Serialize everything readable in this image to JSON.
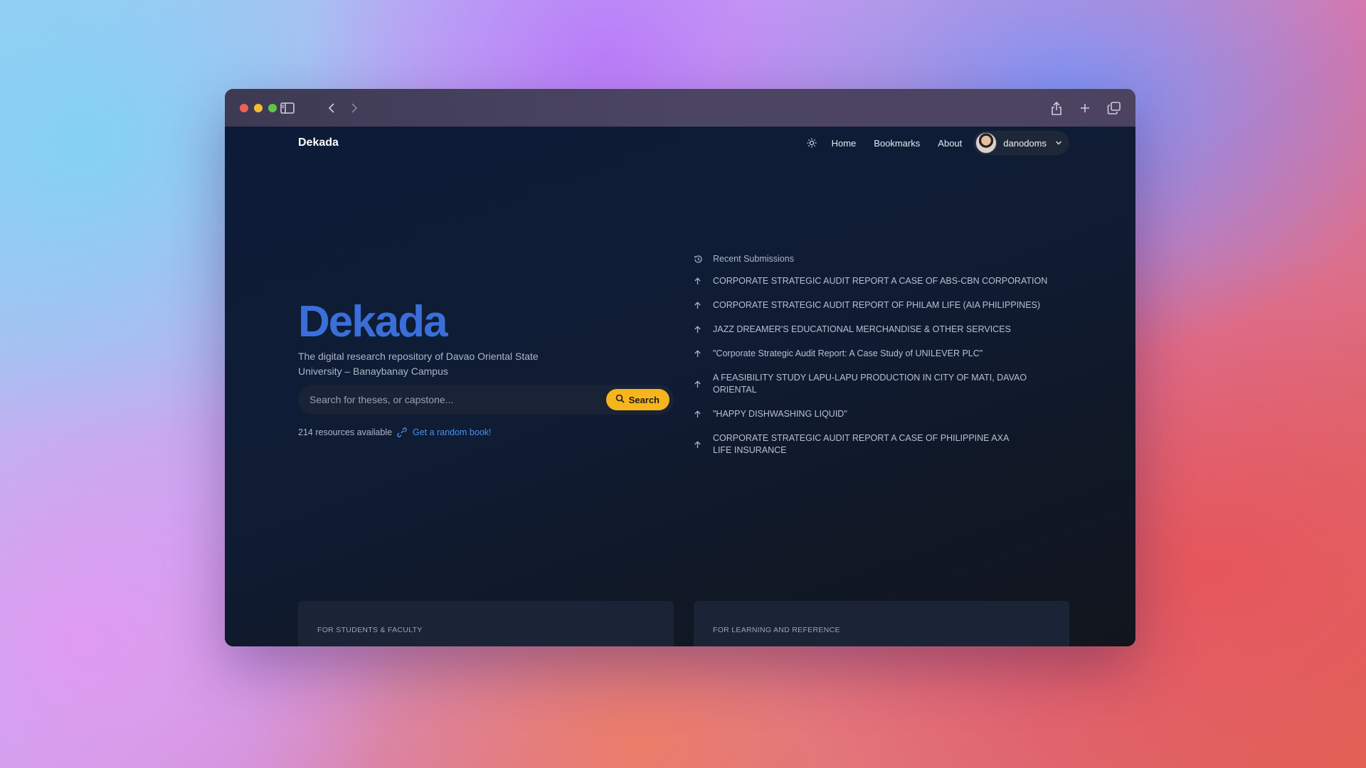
{
  "browser": {
    "icons": [
      "sidebar-toggle-icon",
      "back-arrow-icon",
      "forward-arrow-icon",
      "share-icon",
      "plus-icon",
      "tabs-overview-icon"
    ]
  },
  "nav": {
    "brand": "Dekada",
    "links": [
      "Home",
      "Bookmarks",
      "About"
    ],
    "username": "danodoms"
  },
  "hero": {
    "title": "Dekada",
    "subtitle": "The digital research repository of Davao Oriental State University – Banaybanay Campus"
  },
  "search": {
    "placeholder": "Search for theses, or capstone...",
    "button_label": "Search"
  },
  "resources": {
    "count_text": "214 resources available",
    "random_link": "Get a random book!"
  },
  "recent": {
    "heading": "Recent Submissions",
    "items": [
      "CORPORATE STRATEGIC AUDIT REPORT A CASE OF ABS-CBN CORPORATION",
      "CORPORATE STRATEGIC AUDIT REPORT OF PHILAM LIFE (AIA PHILIPPINES)",
      "JAZZ DREAMER'S EDUCATIONAL MERCHANDISE & OTHER SERVICES",
      "\"Corporate Strategic Audit Report: A Case Study of UNILEVER PLC\"",
      "A FEASIBILITY STUDY LAPU-LAPU PRODUCTION IN CITY OF MATI, DAVAO ORIENTAL",
      "\"HAPPY DISHWASHING LIQUID\"",
      "CORPORATE STRATEGIC AUDIT REPORT  A CASE OF PHILIPPINE AXA LIFE INSURANCE"
    ]
  },
  "cards": {
    "left_label": "FOR STUDENTS & FACULTY",
    "right_label": "FOR LEARNING AND REFERENCE"
  },
  "colors": {
    "accent": "#3a6fd9",
    "search_button": "#f6b51c",
    "link": "#4a90f0"
  }
}
